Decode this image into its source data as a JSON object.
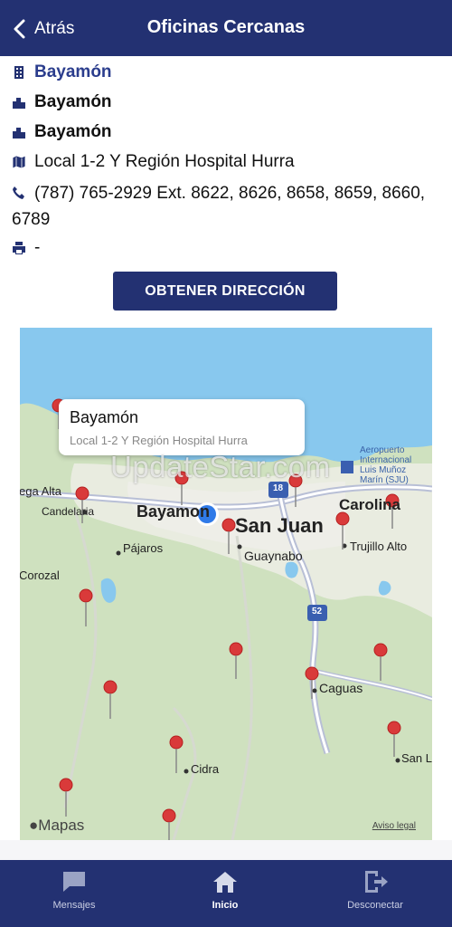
{
  "header": {
    "back_label": "Atrás",
    "title": "Oficinas Cercanas"
  },
  "office": {
    "name": "Bayamón",
    "region": "Bayamón",
    "city": "Bayamón",
    "address": "Local 1-2 Y Región Hospital Hurra",
    "phone": "(787) 765-2929 Ext. 8622, 8626, 8658, 8659, 8660, 6789",
    "fax": "-"
  },
  "directions_button": "OBTENER DIRECCIÓN",
  "map": {
    "callout_title": "Bayamón",
    "callout_subtitle": "Local 1-2 Y Región Hospital Hurra",
    "labels": {
      "vega_alta": "ega Alta",
      "candelaria": "Candelaria",
      "bayamon": "Bayamon",
      "san_juan": "San Juan",
      "carolina": "Carolina",
      "guaynabo": "Guaynabo",
      "pajaros": "Pájaros",
      "trujillo": "Trujillo Alto",
      "corozal": "Corozal",
      "caguas": "Caguas",
      "cidra": "Cidra",
      "san_lo": "San Lo",
      "airport": "Aeropuerto\nInternacional\nLuis Muñoz\nMarín (SJU)",
      "hw18": "18",
      "hw52": "52"
    },
    "watermark": "UpdateStar.com",
    "attribution": "Mapas",
    "legal": "Aviso legal"
  },
  "tabs": [
    {
      "label": "Mensajes",
      "icon": "chat-icon"
    },
    {
      "label": "Inicio",
      "icon": "home-icon"
    },
    {
      "label": "Desconectar",
      "icon": "logout-icon"
    }
  ]
}
